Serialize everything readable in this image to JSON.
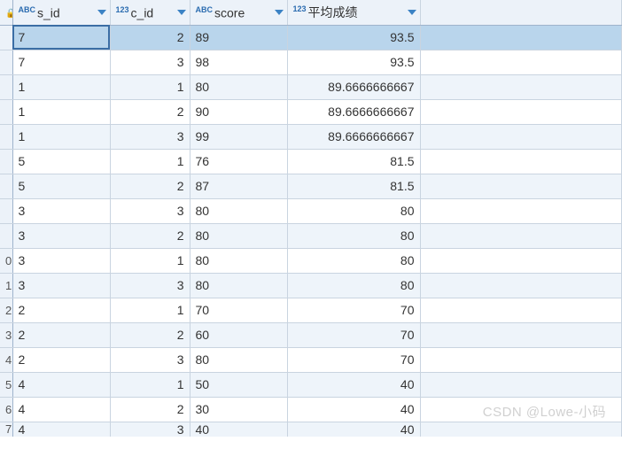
{
  "columns": [
    {
      "name": "s_id",
      "type_badge": "ABC",
      "align": "txt"
    },
    {
      "name": "c_id",
      "type_badge": "123",
      "align": "num"
    },
    {
      "name": "score",
      "type_badge": "ABC",
      "align": "txt"
    },
    {
      "name": "平均成绩",
      "type_badge": "123",
      "align": "num"
    }
  ],
  "rows": [
    {
      "n": "",
      "s_id": "7",
      "c_id": "2",
      "score": "89",
      "avg": "93.5",
      "selected": true
    },
    {
      "n": "",
      "s_id": "7",
      "c_id": "3",
      "score": "98",
      "avg": "93.5"
    },
    {
      "n": "",
      "s_id": "1",
      "c_id": "1",
      "score": "80",
      "avg": "89.6666666667"
    },
    {
      "n": "",
      "s_id": "1",
      "c_id": "2",
      "score": "90",
      "avg": "89.6666666667"
    },
    {
      "n": "",
      "s_id": "1",
      "c_id": "3",
      "score": "99",
      "avg": "89.6666666667"
    },
    {
      "n": "",
      "s_id": "5",
      "c_id": "1",
      "score": "76",
      "avg": "81.5"
    },
    {
      "n": "",
      "s_id": "5",
      "c_id": "2",
      "score": "87",
      "avg": "81.5"
    },
    {
      "n": "",
      "s_id": "3",
      "c_id": "3",
      "score": "80",
      "avg": "80"
    },
    {
      "n": "",
      "s_id": "3",
      "c_id": "2",
      "score": "80",
      "avg": "80"
    },
    {
      "n": "0",
      "s_id": "3",
      "c_id": "1",
      "score": "80",
      "avg": "80"
    },
    {
      "n": "1",
      "s_id": "3",
      "c_id": "3",
      "score": "80",
      "avg": "80"
    },
    {
      "n": "2",
      "s_id": "2",
      "c_id": "1",
      "score": "70",
      "avg": "70"
    },
    {
      "n": "3",
      "s_id": "2",
      "c_id": "2",
      "score": "60",
      "avg": "70"
    },
    {
      "n": "4",
      "s_id": "2",
      "c_id": "3",
      "score": "80",
      "avg": "70"
    },
    {
      "n": "5",
      "s_id": "4",
      "c_id": "1",
      "score": "50",
      "avg": "40"
    },
    {
      "n": "6",
      "s_id": "4",
      "c_id": "2",
      "score": "30",
      "avg": "40"
    },
    {
      "n": "7",
      "s_id": "4",
      "c_id": "3",
      "score": "40",
      "avg": "40",
      "partial": true
    }
  ],
  "icons": {
    "lock": "🔒"
  },
  "watermark": "CSDN @Lowe-小码"
}
